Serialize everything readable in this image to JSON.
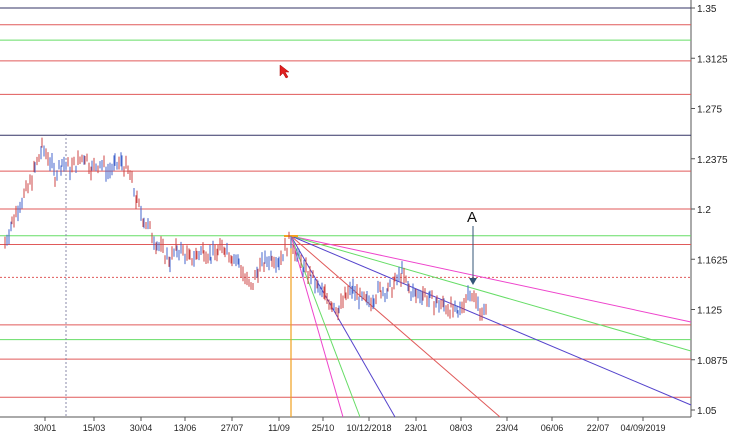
{
  "chart_data": {
    "type": "candlestick",
    "annotation_label": "A",
    "y_ticks": [
      "1.35",
      "1.3125",
      "1.275",
      "1.2375",
      "1.2",
      "1.1625",
      "1.125",
      "1.0875",
      "1.05"
    ],
    "x_ticks": [
      "30/01",
      "15/03",
      "30/04",
      "13/06",
      "27/07",
      "11/09",
      "25/10",
      "10/12/2018",
      "23/01",
      "08/03",
      "23/04",
      "06/06",
      "22/07",
      "04/09/2019"
    ],
    "ylim": [
      1.05,
      1.35
    ],
    "horizontal_levels": [
      {
        "value": 1.35,
        "color": "#333366"
      },
      {
        "value": 1.3375,
        "color": "#e05a5a"
      },
      {
        "value": 1.326,
        "color": "#66dd66"
      },
      {
        "value": 1.3105,
        "color": "#e05a5a"
      },
      {
        "value": 1.2855,
        "color": "#e05a5a"
      },
      {
        "value": 1.255,
        "color": "#333366"
      },
      {
        "value": 1.2283,
        "color": "#e05a5a"
      },
      {
        "value": 1.2,
        "color": "#e05a5a"
      },
      {
        "value": 1.18,
        "color": "#66dd66"
      },
      {
        "value": 1.1735,
        "color": "#e05a5a"
      },
      {
        "value": 1.149,
        "color": "#e05a5a",
        "style": "dotted"
      },
      {
        "value": 1.1135,
        "color": "#e05a5a"
      },
      {
        "value": 1.1025,
        "color": "#66dd66"
      },
      {
        "value": 1.088,
        "color": "#e05a5a"
      },
      {
        "value": 1.0595,
        "color": "#e05a5a"
      }
    ],
    "price_series": {
      "name": "price",
      "points": [
        [
          5,
          1.175
        ],
        [
          12,
          1.19
        ],
        [
          20,
          1.205
        ],
        [
          28,
          1.215
        ],
        [
          35,
          1.23
        ],
        [
          42,
          1.245
        ],
        [
          48,
          1.24
        ],
        [
          55,
          1.225
        ],
        [
          62,
          1.235
        ],
        [
          70,
          1.23
        ],
        [
          78,
          1.235
        ],
        [
          85,
          1.24
        ],
        [
          92,
          1.23
        ],
        [
          100,
          1.235
        ],
        [
          108,
          1.228
        ],
        [
          115,
          1.232
        ],
        [
          122,
          1.235
        ],
        [
          130,
          1.225
        ],
        [
          137,
          1.205
        ],
        [
          144,
          1.192
        ],
        [
          150,
          1.184
        ],
        [
          157,
          1.174
        ],
        [
          163,
          1.168
        ],
        [
          170,
          1.162
        ],
        [
          177,
          1.17
        ],
        [
          183,
          1.168
        ],
        [
          190,
          1.162
        ],
        [
          197,
          1.166
        ],
        [
          204,
          1.17
        ],
        [
          211,
          1.165
        ],
        [
          218,
          1.168
        ],
        [
          225,
          1.172
        ],
        [
          232,
          1.165
        ],
        [
          239,
          1.16
        ],
        [
          245,
          1.148
        ],
        [
          251,
          1.14
        ],
        [
          258,
          1.155
        ],
        [
          265,
          1.16
        ],
        [
          272,
          1.165
        ],
        [
          279,
          1.162
        ],
        [
          285,
          1.17
        ],
        [
          291,
          1.178
        ],
        [
          297,
          1.165
        ],
        [
          304,
          1.155
        ],
        [
          311,
          1.15
        ],
        [
          318,
          1.14
        ],
        [
          325,
          1.135
        ],
        [
          332,
          1.13
        ],
        [
          339,
          1.125
        ],
        [
          346,
          1.135
        ],
        [
          353,
          1.14
        ],
        [
          360,
          1.133
        ],
        [
          367,
          1.13
        ],
        [
          374,
          1.135
        ],
        [
          381,
          1.14
        ],
        [
          388,
          1.138
        ],
        [
          395,
          1.145
        ],
        [
          402,
          1.152
        ],
        [
          409,
          1.14
        ],
        [
          416,
          1.135
        ],
        [
          423,
          1.138
        ],
        [
          430,
          1.132
        ],
        [
          437,
          1.13
        ],
        [
          444,
          1.128
        ],
        [
          451,
          1.126
        ],
        [
          458,
          1.12
        ],
        [
          464,
          1.132
        ],
        [
          470,
          1.14
        ],
        [
          476,
          1.13
        ],
        [
          482,
          1.124
        ],
        [
          488,
          1.12
        ]
      ]
    }
  }
}
